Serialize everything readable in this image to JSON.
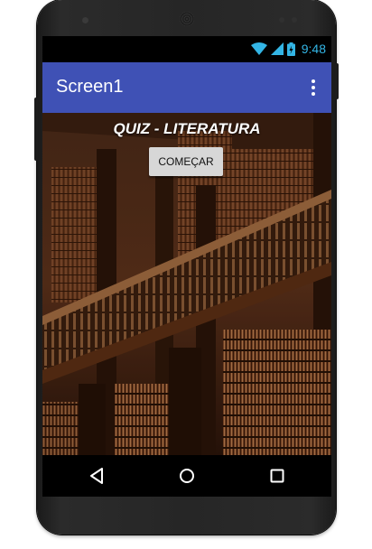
{
  "status_bar": {
    "time": "9:48",
    "icons": [
      "wifi-icon",
      "signal-icon",
      "battery-icon"
    ],
    "color": "#33b5e5"
  },
  "app_bar": {
    "title": "Screen1",
    "menu_icon": "more-vert-icon",
    "color": "#3f51b5"
  },
  "content": {
    "title": "QUIZ - LITERATURA",
    "start_button": "COMEÇAR",
    "background": "library-photo"
  },
  "nav_bar": {
    "icons": [
      "back-icon",
      "home-icon",
      "recents-icon"
    ]
  }
}
